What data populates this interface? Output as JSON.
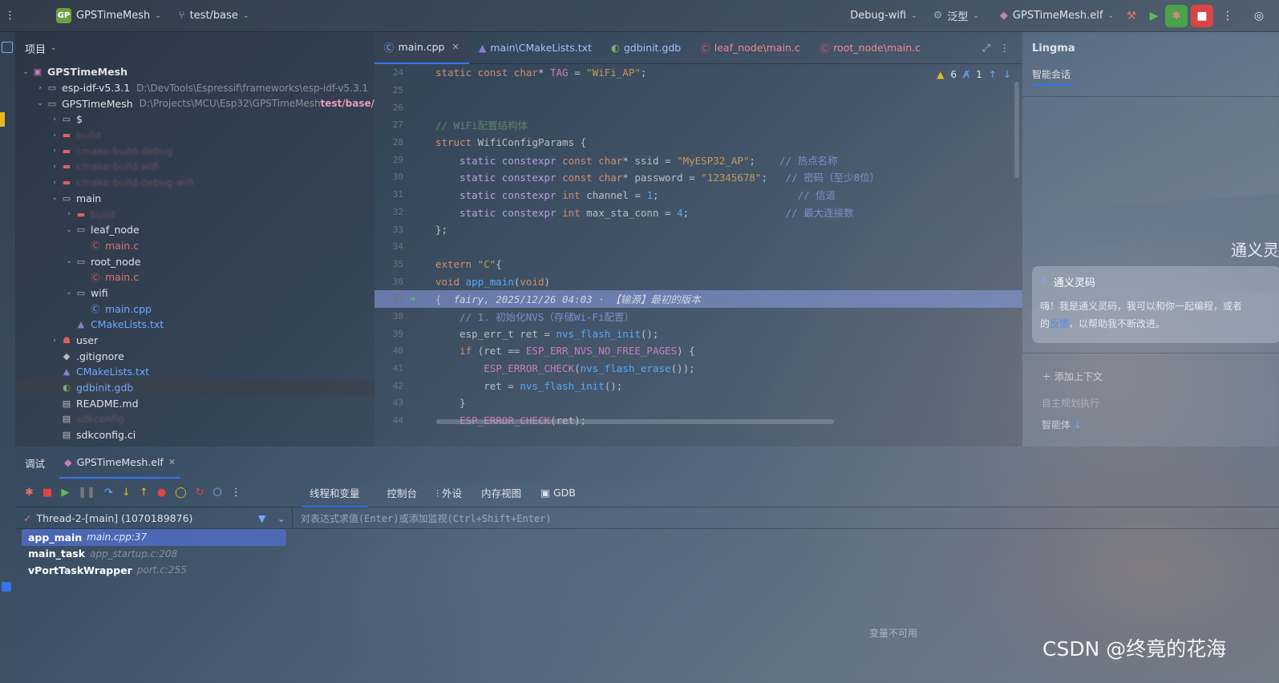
{
  "topbar": {
    "project_badge": "GP",
    "project_name": "GPSTimeMesh",
    "branch": "test/base",
    "config": "Debug-wifi",
    "generic": "泛型",
    "run_target": "GPSTimeMesh.elf"
  },
  "project_panel": {
    "title": "项目",
    "tree": [
      {
        "indent": 0,
        "arrow": "⌄",
        "icon": "project",
        "label": "GPSTimeMesh",
        "bold": true
      },
      {
        "indent": 1,
        "arrow": "›",
        "icon": "folder",
        "label": "esp-idf-v5.3.1",
        "path": "D:\\DevTools\\Espressif\\frameworks\\esp-idf-v5.3.1"
      },
      {
        "indent": 1,
        "arrow": "⌄",
        "icon": "folder",
        "label": "GPSTimeMesh",
        "path": "D:\\Projects\\MCU\\Esp32\\GPSTimeMesh",
        "branch": "test/base/"
      },
      {
        "indent": 2,
        "arrow": "›",
        "icon": "folder",
        "label": "$"
      },
      {
        "indent": 2,
        "arrow": "›",
        "icon": "folder-red",
        "label": "build",
        "blurry": true
      },
      {
        "indent": 2,
        "arrow": "›",
        "icon": "folder-red",
        "label": "cmake-build-debug",
        "blurry": true
      },
      {
        "indent": 2,
        "arrow": "›",
        "icon": "folder-red",
        "label": "cmake-build-wifi",
        "blurry": true
      },
      {
        "indent": 2,
        "arrow": "›",
        "icon": "folder-red",
        "label": "cmake-build-debug-wifi",
        "blurry": true
      },
      {
        "indent": 2,
        "arrow": "⌄",
        "icon": "folder",
        "label": "main"
      },
      {
        "indent": 3,
        "arrow": "›",
        "icon": "folder-red",
        "label": "build",
        "blurry": true
      },
      {
        "indent": 3,
        "arrow": "⌄",
        "icon": "folder",
        "label": "leaf_node"
      },
      {
        "indent": 4,
        "arrow": "",
        "icon": "c-file",
        "label": "main.c",
        "red": true
      },
      {
        "indent": 3,
        "arrow": "⌄",
        "icon": "folder",
        "label": "root_node"
      },
      {
        "indent": 4,
        "arrow": "",
        "icon": "c-file",
        "label": "main.c",
        "red": true
      },
      {
        "indent": 3,
        "arrow": "⌄",
        "icon": "folder",
        "label": "wifi"
      },
      {
        "indent": 4,
        "arrow": "",
        "icon": "cpp-file",
        "label": "main.cpp",
        "blue": true
      },
      {
        "indent": 3,
        "arrow": "",
        "icon": "cmake",
        "label": "CMakeLists.txt",
        "blue": true
      },
      {
        "indent": 2,
        "arrow": "›",
        "icon": "user",
        "label": "user"
      },
      {
        "indent": 2,
        "arrow": "",
        "icon": "git",
        "label": ".gitignore"
      },
      {
        "indent": 2,
        "arrow": "",
        "icon": "cmake",
        "label": "CMakeLists.txt",
        "blue": true
      },
      {
        "indent": 2,
        "arrow": "",
        "icon": "gdb",
        "label": "gdbinit.gdb",
        "blue": true,
        "selected": true
      },
      {
        "indent": 2,
        "arrow": "",
        "icon": "doc",
        "label": "README.md"
      },
      {
        "indent": 2,
        "arrow": "",
        "icon": "doc",
        "label": "sdkconfig",
        "blurry": true
      },
      {
        "indent": 2,
        "arrow": "",
        "icon": "doc",
        "label": "sdkconfig.ci"
      }
    ]
  },
  "editor": {
    "tabs": [
      {
        "icon": "cpp-icon",
        "label": "main.cpp",
        "active": true
      },
      {
        "icon": "cmake-icon",
        "label": "main\\CMakeLists.txt"
      },
      {
        "icon": "gdb-icon",
        "label": "gdbinit.gdb"
      },
      {
        "icon": "c-icon",
        "label": "leaf_node\\main.c"
      },
      {
        "icon": "c-icon",
        "label": "root_node\\main.c"
      }
    ],
    "warnings": "6",
    "typos": "1",
    "lines": [
      {
        "n": "24",
        "html": "<span class='kw'>static const char</span>* <span class='mg'>TAG</span> = <span class='st'>\"WiFi_AP\"</span>;"
      },
      {
        "n": "25",
        "html": ""
      },
      {
        "n": "26",
        "html": ""
      },
      {
        "n": "27",
        "html": "<span class='cm'>// WiFi配置结构体</span>"
      },
      {
        "n": "28",
        "html": "<span class='kw'>struct</span> WifiConfigParams {"
      },
      {
        "n": "29",
        "html": "    <span class='pu'>static constexpr</span> <span class='kw'>const char</span>* ssid = <span class='st'>\"MyESP32_AP\"</span>;    <span class='cm-blue'>// 热点名称</span>"
      },
      {
        "n": "30",
        "html": "    <span class='pu'>static constexpr</span> <span class='kw'>const char</span>* password = <span class='st'>\"12345678\"</span>;   <span class='cm-blue'>// 密码（至少8位）</span>"
      },
      {
        "n": "31",
        "html": "    <span class='pu'>static constexpr</span> <span class='kw'>int</span> channel = <span class='fn'>1</span>;                       <span class='cm-blue'>// 信道</span>"
      },
      {
        "n": "32",
        "html": "    <span class='pu'>static constexpr</span> <span class='kw'>int</span> max_sta_conn = <span class='fn'>4</span>;                <span class='cm-blue'>// 最大连接数</span>"
      },
      {
        "n": "33",
        "html": "};"
      },
      {
        "n": "34",
        "html": ""
      },
      {
        "n": "35",
        "html": "<span class='kw'>extern</span> <span class='st'>\"C\"</span>{"
      },
      {
        "n": "36",
        "html": "<span class='kw'>void</span> <span class='fn'>app_main</span>(<span class='kw'>void</span>)"
      },
      {
        "n": "37",
        "html": "{  <span class='ghost'>fairy, 2025/12/26 04:03 · 【输源】最初的版本</span>",
        "current": true
      },
      {
        "n": "38",
        "html": "    <span class='cm-blue'>// 1. 初始化NVS（存储Wi-Fi配置）</span>"
      },
      {
        "n": "39",
        "html": "    esp_err_t ret = <span class='fn'>nvs_flash_init</span>();"
      },
      {
        "n": "40",
        "html": "    <span class='kw'>if</span> (ret == <span class='mg'>ESP_ERR_NVS_NO_FREE_PAGES</span>) {"
      },
      {
        "n": "41",
        "html": "        <span class='mg'>ESP_ERROR_CHECK</span>(<span class='fn'>nvs_flash_erase</span>());"
      },
      {
        "n": "42",
        "html": "        ret = <span class='fn'>nvs_flash_init</span>();"
      },
      {
        "n": "43",
        "html": "    }"
      },
      {
        "n": "44",
        "html": "    <span class='mg'>ESP_ERROR_CHECK</span>(ret);"
      }
    ]
  },
  "lingma": {
    "title": "Lingma",
    "tab": "智能会话",
    "brand": "通义灵",
    "card_title": "通义灵码",
    "card_line1": "嗨！我是通义灵码，我可以和你一起编程，或者",
    "card_line2_pre": "的",
    "card_link": "反馈",
    "card_line2_post": "，以帮助我不断改进。",
    "add_context": "添加上下文",
    "placeholder": "自主规划执行",
    "agent": "智能体"
  },
  "debug": {
    "title": "调试",
    "session": "GPSTimeMesh.elf",
    "subtabs": [
      "线程和变量",
      "控制台",
      "外设",
      "内存视图",
      "GDB"
    ],
    "thread": "Thread-2-[main] (1070189876)",
    "frames": [
      {
        "fn": "app_main",
        "loc": "main.cpp:37",
        "selected": true
      },
      {
        "fn": "main_task",
        "loc": "app_startup.c:208"
      },
      {
        "fn": "vPortTaskWrapper",
        "loc": "port.c:255"
      }
    ],
    "eval_placeholder": "对表达式求值(Enter)或添加监视(Ctrl+Shift+Enter)",
    "no_vars": "变量不可用"
  },
  "watermark": "CSDN @终竟的花海"
}
